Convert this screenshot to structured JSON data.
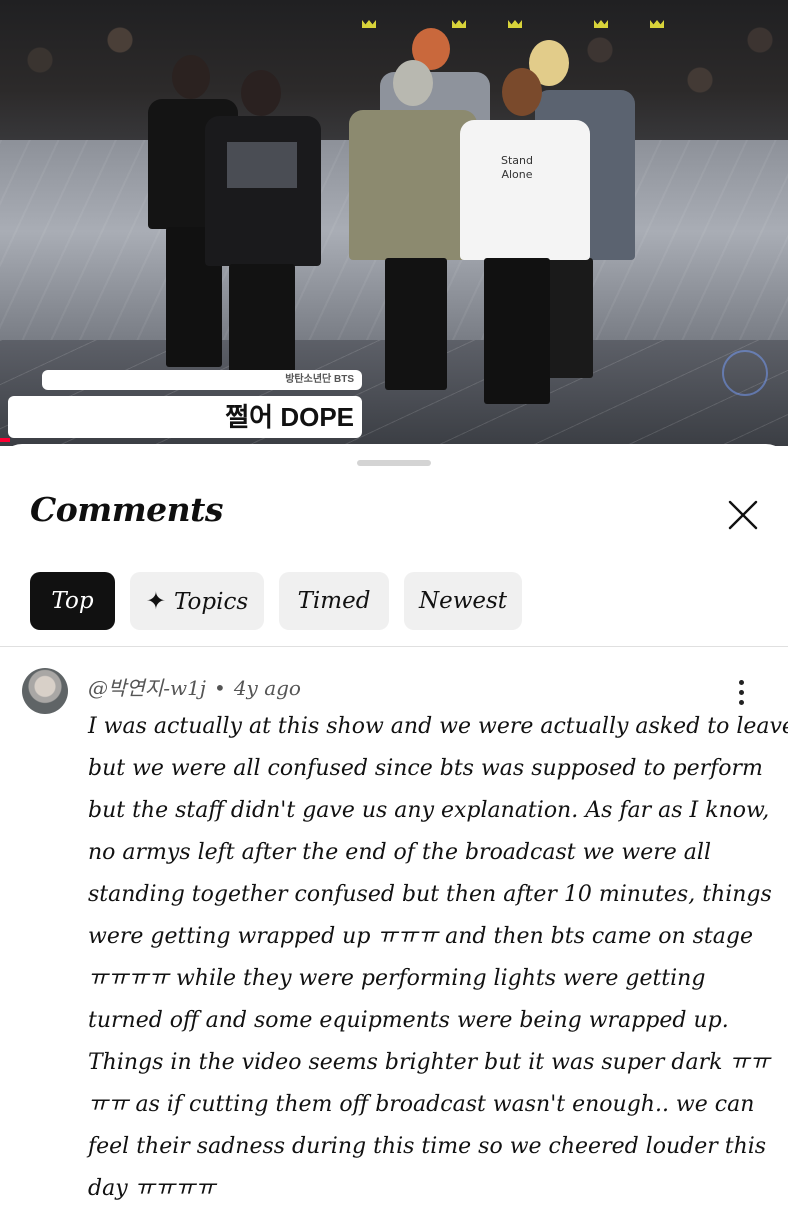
{
  "video": {
    "shirt_text": "Stand\nAlone",
    "lower_third_small": "방탄소년단 BTS",
    "caption": "쩔어 DOPE"
  },
  "comments_sheet": {
    "title": "Comments",
    "close_icon": "close-icon",
    "tabs": [
      {
        "label": "Top",
        "active": true
      },
      {
        "label": "Topics",
        "icon": "sparkle-icon",
        "active": false
      },
      {
        "label": "Timed",
        "active": false
      },
      {
        "label": "Newest",
        "active": false
      }
    ]
  },
  "comment": {
    "author": "@박연지-w1j",
    "age": "4y ago",
    "lines": [
      "I was actually at this show and we were actually asked to leave",
      "but we were all confused since bts was supposed to perform",
      "but the staff didn't gave us any explanation. As far as I know,",
      "no armys left after the end of the broadcast we were all",
      "standing together confused but then after 10 minutes, things",
      "were getting wrapped up ㅠㅠㅠ and then bts came on stage",
      "ㅠㅠㅠㅠ while they were performing lights were getting",
      "turned off and some equipments were being wrapped up.",
      "Things in the video seems brighter but it was super dark ㅠㅠ",
      "ㅠㅠ as if cutting them off broadcast wasn't enough.. we can",
      "feel their sadness during this time so we cheered louder this",
      "day ㅠㅠㅠㅠ"
    ]
  },
  "colors": {
    "accent_dark": "#111111",
    "chip_bg": "#f0f0f0",
    "progress_red": "#ff0033"
  }
}
